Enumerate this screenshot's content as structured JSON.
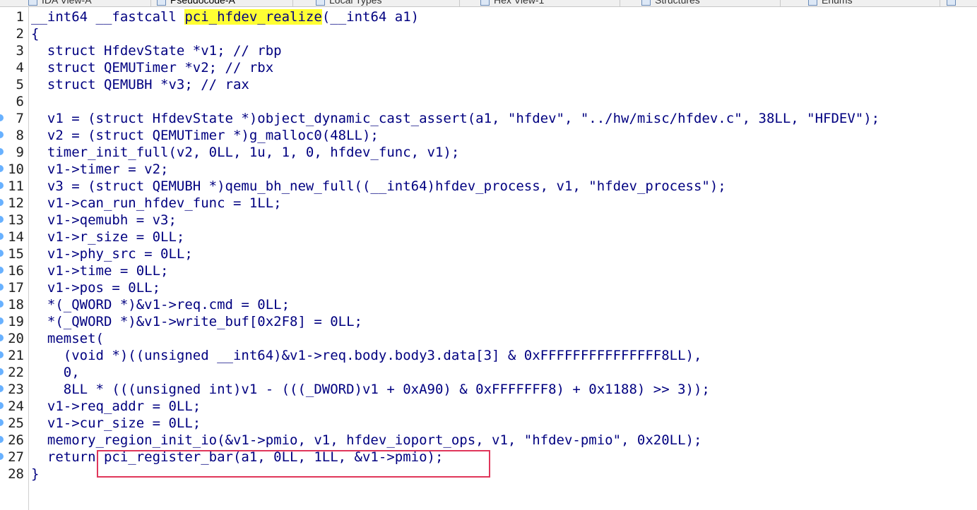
{
  "tabs": [
    {
      "label": "IDA View-A"
    },
    {
      "label": "Pseudocode-A"
    },
    {
      "label": "Local Types"
    },
    {
      "label": "Hex View-1"
    },
    {
      "label": "Structures"
    },
    {
      "label": "Enums"
    }
  ],
  "code": {
    "lines": [
      {
        "n": "1",
        "text": "__int64 __fastcall ",
        "highlight": "pci_hfdev_realize",
        "after": "(__int64 a1)"
      },
      {
        "n": "2",
        "text": "{"
      },
      {
        "n": "3",
        "text": "  struct HfdevState *v1; // rbp"
      },
      {
        "n": "4",
        "text": "  struct QEMUTimer *v2; // rbx"
      },
      {
        "n": "5",
        "text": "  struct QEMUBH *v3; // rax"
      },
      {
        "n": "6",
        "text": ""
      },
      {
        "n": "7",
        "text": "  v1 = (struct HfdevState *)object_dynamic_cast_assert(a1, \"hfdev\", \"../hw/misc/hfdev.c\", 38LL, \"HFDEV\");"
      },
      {
        "n": "8",
        "text": "  v2 = (struct QEMUTimer *)g_malloc0(48LL);"
      },
      {
        "n": "9",
        "text": "  timer_init_full(v2, 0LL, 1u, 1, 0, hfdev_func, v1);"
      },
      {
        "n": "10",
        "text": "  v1->timer = v2;"
      },
      {
        "n": "11",
        "text": "  v3 = (struct QEMUBH *)qemu_bh_new_full((__int64)hfdev_process, v1, \"hfdev_process\");"
      },
      {
        "n": "12",
        "text": "  v1->can_run_hfdev_func = 1LL;"
      },
      {
        "n": "13",
        "text": "  v1->qemubh = v3;"
      },
      {
        "n": "14",
        "text": "  v1->r_size = 0LL;"
      },
      {
        "n": "15",
        "text": "  v1->phy_src = 0LL;"
      },
      {
        "n": "16",
        "text": "  v1->time = 0LL;"
      },
      {
        "n": "17",
        "text": "  v1->pos = 0LL;"
      },
      {
        "n": "18",
        "text": "  *(_QWORD *)&v1->req.cmd = 0LL;"
      },
      {
        "n": "19",
        "text": "  *(_QWORD *)&v1->write_buf[0x2F8] = 0LL;"
      },
      {
        "n": "20",
        "text": "  memset("
      },
      {
        "n": "21",
        "text": "    (void *)((unsigned __int64)&v1->req.body.body3.data[3] & 0xFFFFFFFFFFFFFFF8LL),"
      },
      {
        "n": "22",
        "text": "    0,"
      },
      {
        "n": "23",
        "text": "    8LL * (((unsigned int)v1 - (((_DWORD)v1 + 0xA90) & 0xFFFFFFF8) + 0x1188) >> 3));"
      },
      {
        "n": "24",
        "text": "  v1->req_addr = 0LL;"
      },
      {
        "n": "25",
        "text": "  v1->cur_size = 0LL;"
      },
      {
        "n": "26",
        "text": "  memory_region_init_io(&v1->pmio, v1, hfdev_ioport_ops, v1, \"hfdev-pmio\", 0x20LL);"
      },
      {
        "n": "27",
        "text": "  return pci_register_bar(a1, 0LL, 1LL, &v1->pmio);"
      },
      {
        "n": "28",
        "text": "}"
      }
    ],
    "breakpoint_lines": [
      "7",
      "8",
      "9",
      "10",
      "11",
      "12",
      "13",
      "14",
      "15",
      "16",
      "17",
      "18",
      "19",
      "20",
      "21",
      "22",
      "23",
      "24",
      "25",
      "26",
      "27"
    ]
  },
  "colors": {
    "code_text": "#000080",
    "highlight": "#ffff33",
    "annotation_box": "#e0365a",
    "breakpoint_dot": "#4da3ff"
  }
}
